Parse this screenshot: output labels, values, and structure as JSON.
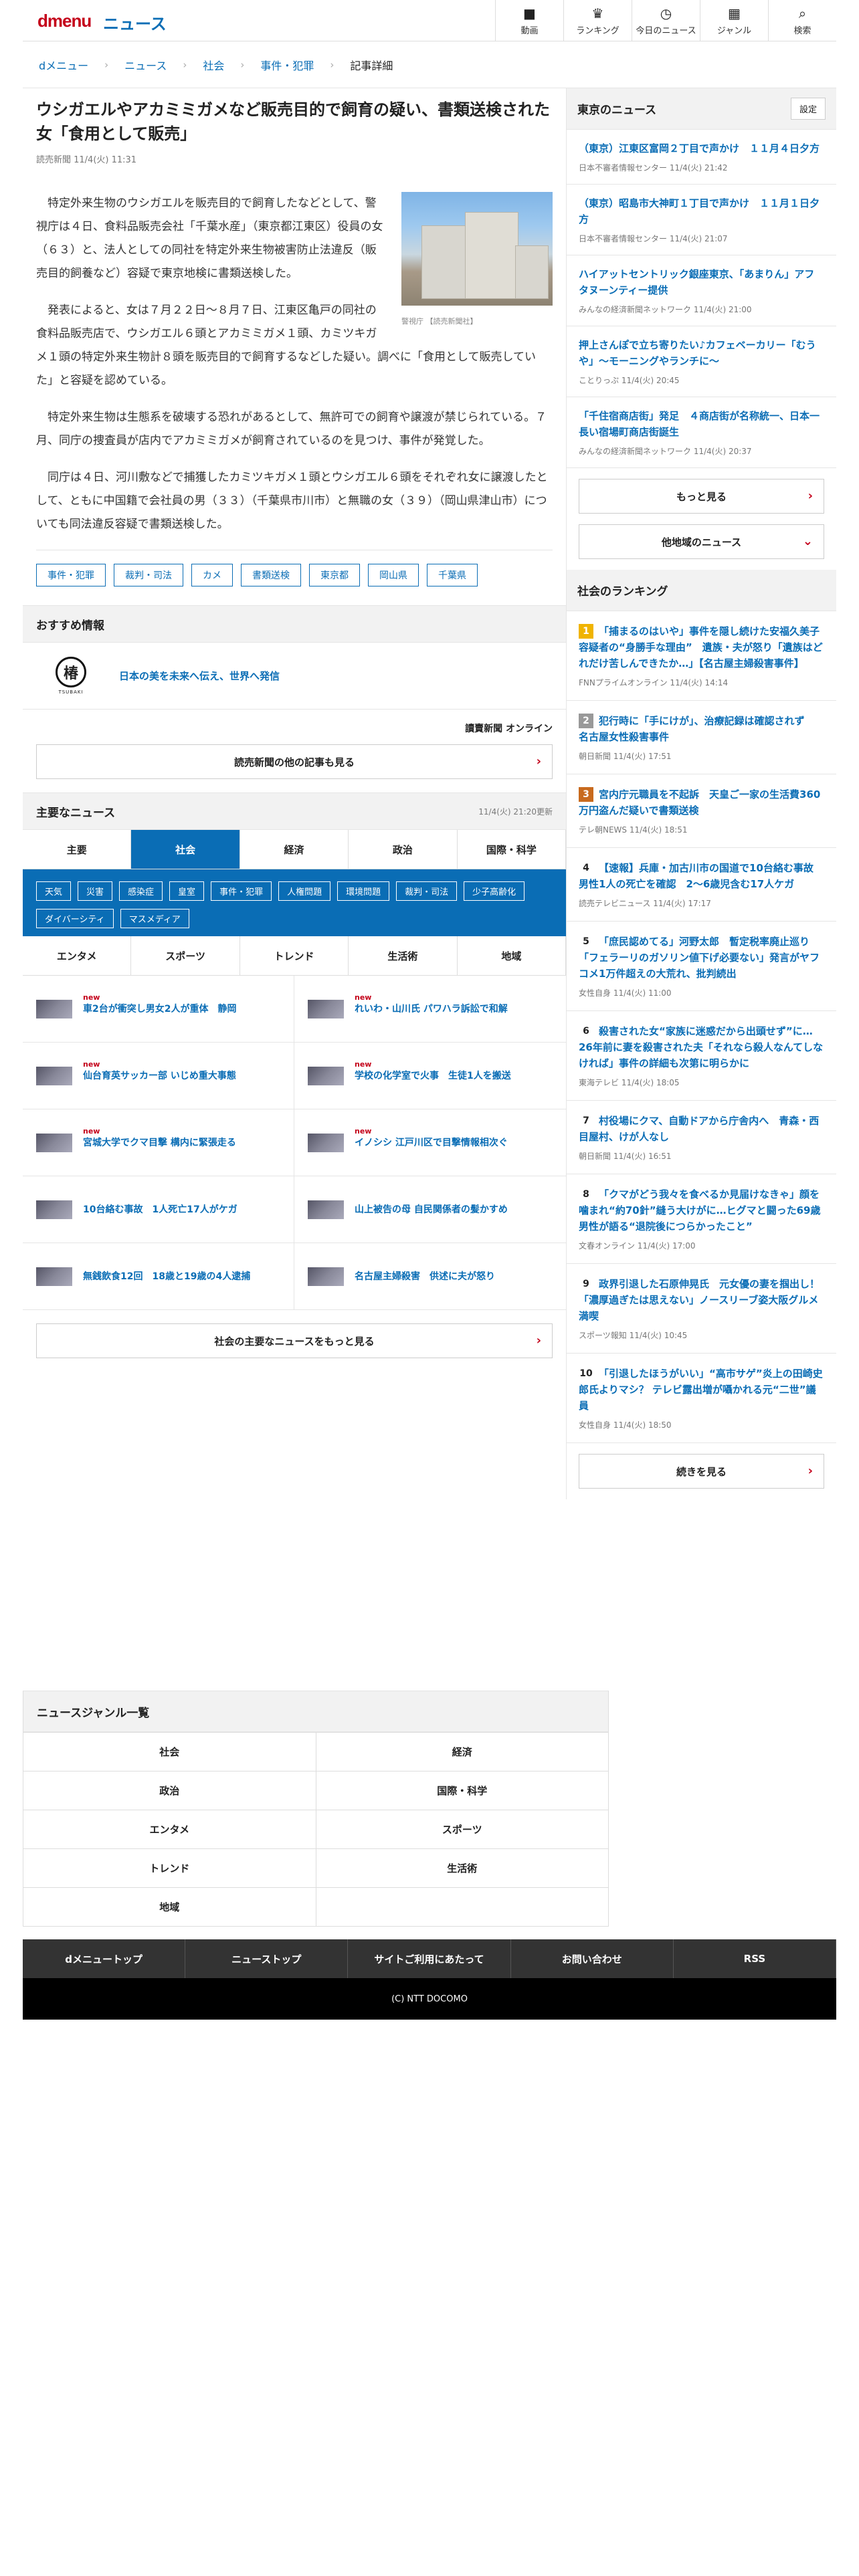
{
  "header": {
    "logo": "dmenu",
    "section": "ニュース",
    "nav": [
      {
        "icon": "video-icon",
        "glyph": "■",
        "label": "動画"
      },
      {
        "icon": "trophy-icon",
        "glyph": "♛",
        "label": "ランキング"
      },
      {
        "icon": "clock-icon",
        "glyph": "◷",
        "label": "今日のニュース"
      },
      {
        "icon": "grid-icon",
        "glyph": "▦",
        "label": "ジャンル"
      },
      {
        "icon": "search-icon",
        "glyph": "⌕",
        "label": "検索"
      }
    ]
  },
  "breadcrumb": [
    "dメニュー",
    "ニュース",
    "社会",
    "事件・犯罪",
    "記事詳細"
  ],
  "article": {
    "title": "ウシガエルやアカミミガメなど販売目的で飼育の疑い、書類送検された女「食用として販売」",
    "source": "読売新聞 11/4(火) 11:31",
    "photo_caption": "警視庁 【読売新聞社】",
    "paragraphs": [
      "特定外来生物のウシガエルを販売目的で飼育したなどとして、警視庁は４日、食料品販売会社「千葉水産」（東京都江東区）役員の女（６３）と、法人としての同社を特定外来生物被害防止法違反（販売目的飼養など）容疑で東京地検に書類送検した。",
      "発表によると、女は７月２２日～８月７日、江東区亀戸の同社の食料品販売店で、ウシガエル６頭とアカミミガメ１頭、カミツキガメ１頭の特定外来生物計８頭を販売目的で飼育するなどした疑い。調べに「食用として販売していた」と容疑を認めている。",
      "特定外来生物は生態系を破壊する恐れがあるとして、無許可での飼育や譲渡が禁じられている。７月、同庁の捜査員が店内でアカミミガメが飼育されているのを見つけ、事件が発覚した。",
      "同庁は４日、河川敷などで捕獲したカミツキガメ１頭とウシガエル６頭をそれぞれ女に譲渡したとして、ともに中国籍で会社員の男（３３）（千葉県市川市）と無職の女（３９）（岡山県津山市）についても同法違反容疑で書類送検した。"
    ],
    "tags": [
      "事件・犯罪",
      "裁判・司法",
      "カメ",
      "書類送検",
      "東京都",
      "岡山県",
      "千葉県"
    ]
  },
  "recommend": {
    "heading": "おすすめ情報",
    "sponsor_logo": "TSUBAKI",
    "promo_text": "日本の美を未来へ伝え、世界へ発信",
    "publisher_logo": "讀賣新聞 オンライン",
    "more_label": "読売新聞の他の記事も見る"
  },
  "major": {
    "heading": "主要なニュース",
    "updated": "11/4(火) 21:20更新",
    "tabs": [
      "主要",
      "社会",
      "経済",
      "政治",
      "国際・科学"
    ],
    "chips": [
      "天気",
      "災害",
      "感染症",
      "皇室",
      "事件・犯罪",
      "人権問題",
      "環境問題",
      "裁判・司法",
      "少子高齢化",
      "ダイバーシティ",
      "マスメディア"
    ],
    "subtabs": [
      "エンタメ",
      "スポーツ",
      "トレンド",
      "生活術",
      "地域"
    ],
    "new_label": "new",
    "items": [
      {
        "title": "車2台が衝突し男女2人が重体　静岡",
        "new": true
      },
      {
        "title": "れいわ・山川氏 パワハラ訴訟で和解",
        "new": true
      },
      {
        "title": "仙台育英サッカー部 いじめ重大事態",
        "new": true
      },
      {
        "title": "学校の化学室で火事　生徒1人を搬送",
        "new": true
      },
      {
        "title": "宮城大学でクマ目撃 構内に緊張走る",
        "new": true
      },
      {
        "title": "イノシシ 江戸川区で目撃情報相次ぐ",
        "new": true
      },
      {
        "title": "10台絡む事故　1人死亡17人がケガ",
        "new": false
      },
      {
        "title": "山上被告の母 自民関係者の髪かすめ",
        "new": false
      },
      {
        "title": "無銭飲食12回　18歳と19歳の4人逮捕",
        "new": false
      },
      {
        "title": "名古屋主婦殺害　供述に夫が怒り",
        "new": false
      }
    ],
    "more_label": "社会の主要なニュースをもっと見る"
  },
  "tokyo": {
    "heading": "東京のニュース",
    "settings_label": "設定",
    "items": [
      {
        "title": "（東京）江東区富岡２丁目で声かけ　１１月４日夕方",
        "meta": "日本不審者情報センター 11/4(火) 21:42"
      },
      {
        "title": "（東京）昭島市大神町１丁目で声かけ　１１月１日夕方",
        "meta": "日本不審者情報センター 11/4(火) 21:07"
      },
      {
        "title": "ハイアットセントリック銀座東京、「あまりん」アフタヌーンティー提供",
        "meta": "みんなの経済新聞ネットワーク 11/4(火) 21:00"
      },
      {
        "title": "押上さんぽで立ち寄りたい♪カフェベーカリー「むうや」～モーニングやランチに～",
        "meta": "ことりっぷ 11/4(火) 20:45"
      },
      {
        "title": "「千住宿商店街」発足　４商店街が名称統一、日本一長い宿場町商店街誕生",
        "meta": "みんなの経済新聞ネットワーク 11/4(火) 20:37"
      }
    ],
    "more_label": "もっと見る",
    "other_label": "他地域のニュース"
  },
  "ranking": {
    "heading": "社会のランキング",
    "items": [
      {
        "rank": "1",
        "title": "「捕まるのはいや」事件を隠し続けた安福久美子容疑者の“身勝手な理由”　遺族・夫が怒り「遺族はどれだけ苦しんできたか…」【名古屋主婦殺害事件】",
        "meta": "FNNプライムオンライン 11/4(火) 14:14"
      },
      {
        "rank": "2",
        "title": "犯行時に「手にけが」、治療記録は確認されず　名古屋女性殺害事件",
        "meta": "朝日新聞 11/4(火) 17:51"
      },
      {
        "rank": "3",
        "title": "宮内庁元職員を不起訴　天皇ご一家の生活費360万円盗んだ疑いで書類送検",
        "meta": "テレ朝NEWS 11/4(火) 18:51"
      },
      {
        "rank": "4",
        "title": "【速報】兵庫・加古川市の国道で10台絡む事故　男性1人の死亡を確認　2～6歳児含む17人ケガ",
        "meta": "読売テレビニュース 11/4(火) 17:17"
      },
      {
        "rank": "5",
        "title": "「庶民認めてる」河野太郎　暫定税率廃止巡り「フェラーリのガソリン値下げ必要ない」発言がヤフコメ1万件超えの大荒れ、批判続出",
        "meta": "女性自身 11/4(火) 11:00"
      },
      {
        "rank": "6",
        "title": "殺害された女“家族に迷惑だから出頭せず”に…26年前に妻を殺害された夫「それなら殺人なんてしなければ」事件の詳細も次第に明らかに",
        "meta": "東海テレビ 11/4(火) 18:05"
      },
      {
        "rank": "7",
        "title": "村役場にクマ、自動ドアから庁舎内へ　青森・西目屋村、けが人なし",
        "meta": "朝日新聞 11/4(火) 16:51"
      },
      {
        "rank": "8",
        "title": "「クマがどう我々を食べるか見届けなきゃ」顔を噛まれ“約70針”縫う大けがに…ヒグマと闘った69歳男性が語る“退院後につらかったこと”",
        "meta": "文春オンライン 11/4(火) 17:00"
      },
      {
        "rank": "9",
        "title": "政界引退した石原伸晃氏　元女優の妻を掴出し！「濃厚過ぎたは思えない」ノースリーブ姿大阪グルメ満喫",
        "meta": "スポーツ報知 11/4(火) 10:45"
      },
      {
        "rank": "10",
        "title": "「引退したほうがいい」“高市サゲ”炎上の田崎史郎氏よりマシ？ テレビ露出増が囁かれる元“二世”議員",
        "meta": "女性自身 11/4(火) 18:50"
      }
    ],
    "more_label": "続きを見る"
  },
  "genres": {
    "heading": "ニュースジャンル一覧",
    "items": [
      "社会",
      "経済",
      "政治",
      "国際・科学",
      "エンタメ",
      "スポーツ",
      "トレンド",
      "生活術",
      "地域"
    ]
  },
  "footer": {
    "links": [
      "dメニュートップ",
      "ニューストップ",
      "サイトご利用にあたって",
      "お問い合わせ",
      "RSS"
    ],
    "copyright": "(C) NTT DOCOMO"
  },
  "colors": {
    "brand": "#c4001a",
    "link": "#0a6db5",
    "rank1": "#f0b400",
    "rank2": "#999999",
    "rank3": "#c86a1e",
    "rank_other": "#888888"
  }
}
